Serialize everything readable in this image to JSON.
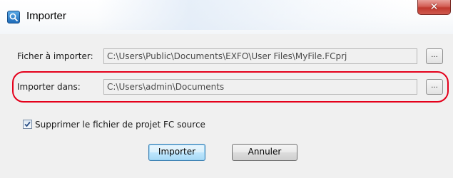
{
  "window": {
    "title": "Importer"
  },
  "form": {
    "file_label": "Ficher à importer:",
    "file_value": "C:\\Users\\Public\\Documents\\EXFO\\User Files\\MyFile.FCprj",
    "import_into_label": "Importer dans:",
    "import_into_value": "C:\\Users\\admin\\Documents",
    "browse_label": "...",
    "delete_source_label": "Supprimer le fichier de projet FC source",
    "delete_source_checked": true
  },
  "buttons": {
    "import_label": "Importer",
    "cancel_label": "Annuler"
  },
  "colors": {
    "highlight": "#e4001b",
    "close_button": "#c7483e"
  },
  "icons": {
    "app": "exfo-app-icon",
    "close": "close-icon",
    "check": "checkmark-icon"
  }
}
